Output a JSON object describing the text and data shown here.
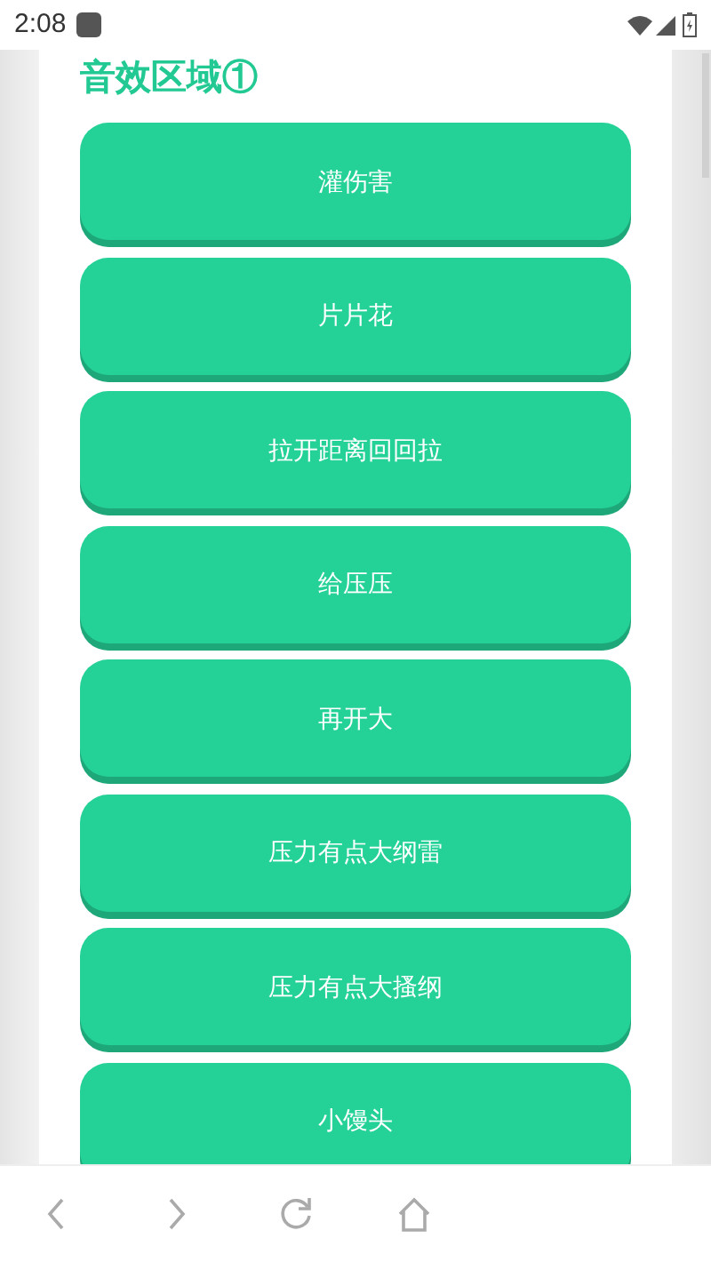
{
  "status_bar": {
    "time": "2:08"
  },
  "section": {
    "title": "音效区域①"
  },
  "sound_buttons": [
    {
      "label": "灌伤害"
    },
    {
      "label": "片片花"
    },
    {
      "label": "拉开距离回回拉"
    },
    {
      "label": "给压压"
    },
    {
      "label": "再开大"
    },
    {
      "label": "压力有点大纲雷"
    },
    {
      "label": "压力有点大搔纲"
    },
    {
      "label": "小馒头"
    }
  ],
  "nav_bar": {
    "buttons": [
      {
        "kind": "back"
      },
      {
        "kind": "forward"
      },
      {
        "kind": "reload"
      },
      {
        "kind": "home"
      }
    ]
  }
}
